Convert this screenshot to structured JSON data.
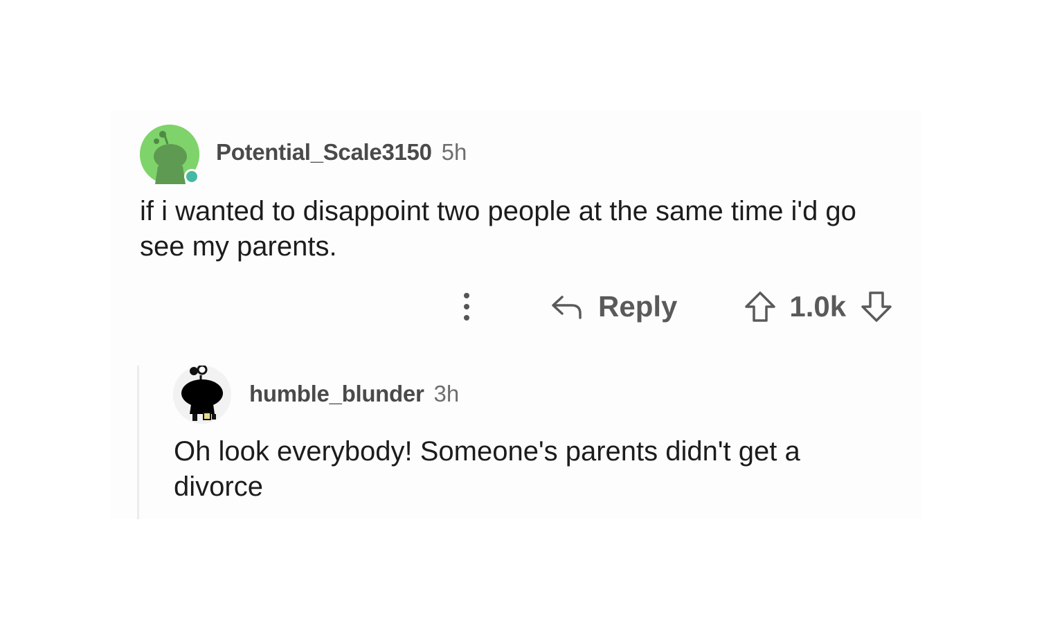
{
  "comments": [
    {
      "username": "Potential_Scale3150",
      "time": "5h",
      "text": "if i wanted to disappoint two people at the same time i'd go see my parents.",
      "avatar_icon": "snoo-avatar-green-icon",
      "avatar_color": "#7ed46a",
      "online": true,
      "actions": {
        "more_icon": "more-vertical-icon",
        "reply_icon": "reply-arrow-icon",
        "reply_label": "Reply",
        "upvote_icon": "upvote-arrow-icon",
        "votes": "1.0k",
        "downvote_icon": "downvote-arrow-icon"
      }
    },
    {
      "username": "humble_blunder",
      "time": "3h",
      "text": "Oh look everybody! Someone's parents didn't get a divorce",
      "avatar_icon": "snoo-avatar-black-icon",
      "avatar_color": "#f2f2f2"
    }
  ],
  "colors": {
    "username": "#4a4a4a",
    "timestamp": "#6e6e6e",
    "body": "#1c1c1c",
    "online_dot": "#46b9a0",
    "thread_line": "#ececec"
  }
}
